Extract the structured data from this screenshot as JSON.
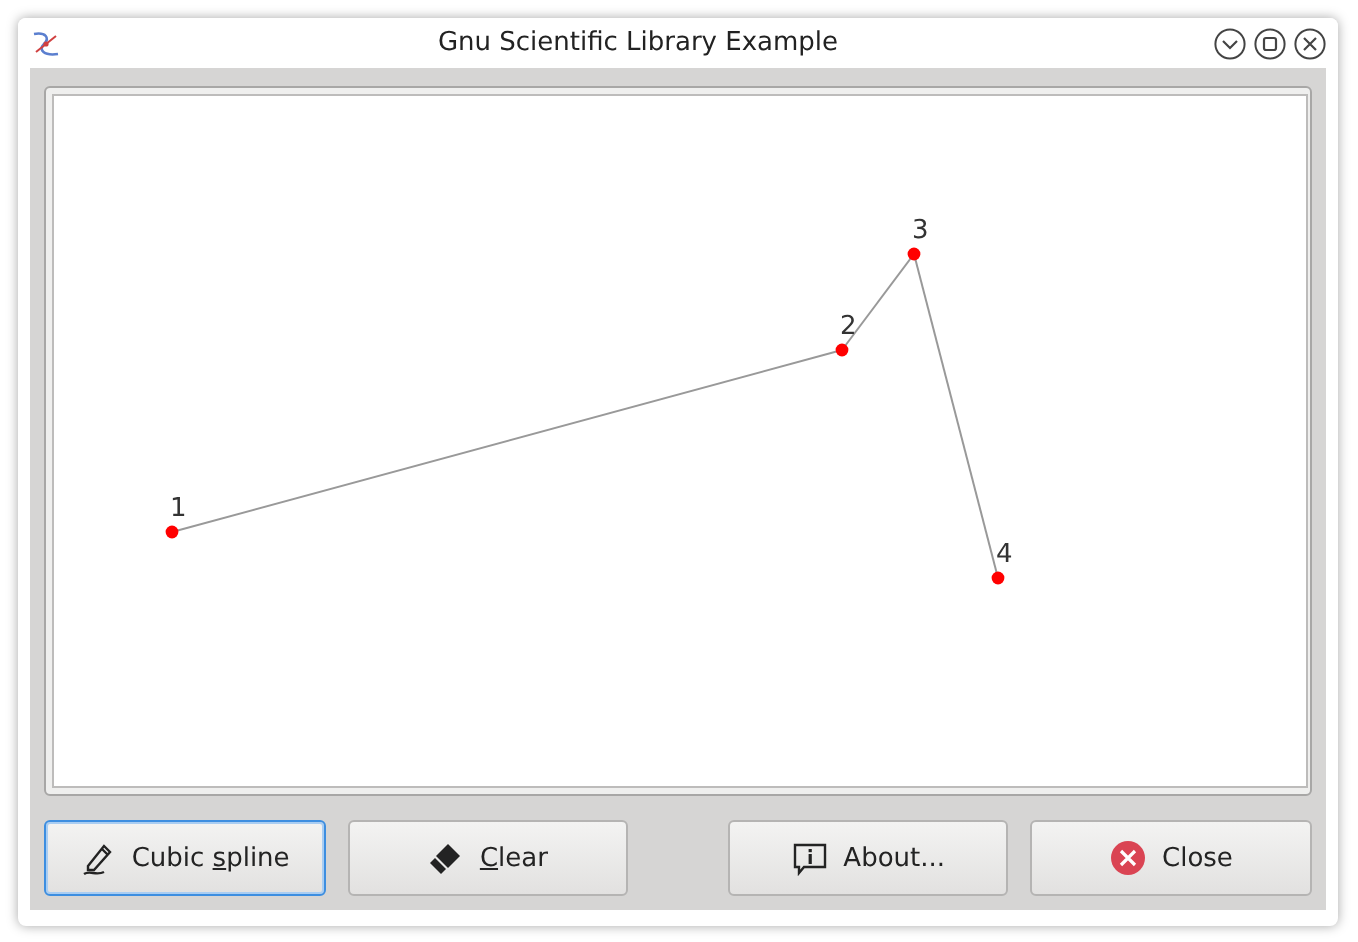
{
  "window": {
    "title": "Gnu Scientific Library Example"
  },
  "canvas": {
    "points": [
      {
        "label": "1"
      },
      {
        "label": "2"
      },
      {
        "label": "3"
      },
      {
        "label": "4"
      }
    ]
  },
  "buttons": [
    {
      "kind": "spline",
      "label_parts": [
        {
          "text": "Cubic ",
          "underlined": false
        },
        {
          "text": "s",
          "underlined": true
        },
        {
          "text": "pline",
          "underlined": false
        }
      ],
      "focused": true
    },
    {
      "kind": "clear",
      "label_parts": [
        {
          "text": "C",
          "underlined": true
        },
        {
          "text": "lear",
          "underlined": false
        }
      ],
      "focused": false
    },
    {
      "kind": "about",
      "label_parts": [
        {
          "text": "About...",
          "underlined": false
        }
      ],
      "focused": false
    },
    {
      "kind": "close",
      "label_parts": [
        {
          "text": "Close",
          "underlined": false
        }
      ],
      "focused": false
    }
  ]
}
